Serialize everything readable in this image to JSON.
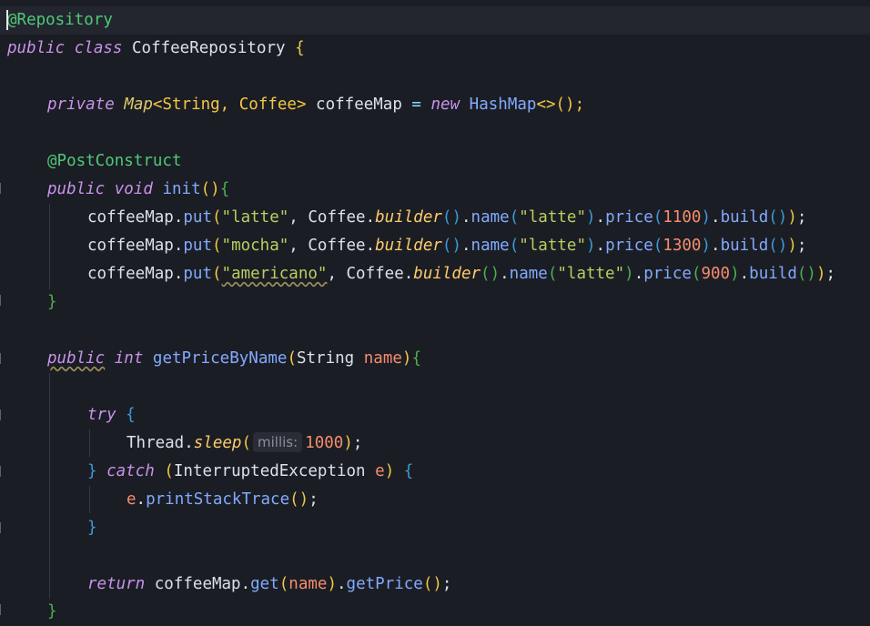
{
  "lines": {
    "l1_annotation": "@Repository",
    "l2_class_decl": {
      "public": "public",
      "class": "class",
      "name": "CoffeeRepository",
      "brace": "{"
    },
    "l4_field": {
      "private": "private",
      "type_map": "Map",
      "generics": "<String, Coffee>",
      "var": "coffeeMap",
      "eq": "=",
      "new": "new",
      "type_hash": "HashMap",
      "diamond": "<>",
      "end": "();"
    },
    "l6_annotation": "@PostConstruct",
    "l7_init": {
      "public": "public",
      "void": "void",
      "name": "init",
      "parens": "()",
      "brace": "{"
    },
    "put_lines": [
      {
        "key": "\"latte\"",
        "name_val": "\"latte\"",
        "price": "1100"
      },
      {
        "key": "\"mocha\"",
        "name_val": "\"latte\"",
        "price": "1300"
      },
      {
        "key": "\"americano\"",
        "name_val": "\"latte\"",
        "price": "900"
      }
    ],
    "put_tokens": {
      "map": "coffeeMap",
      "put": "put",
      "coffee": "Coffee",
      "builder": "builder",
      "name": "name",
      "price": "price",
      "build": "build"
    },
    "l11_close": "}",
    "l13_method": {
      "public": "public",
      "int": "int",
      "name": "getPriceByName",
      "ptype": "String",
      "pname": "name"
    },
    "try_kw": "try",
    "thread": "Thread",
    "sleep": "sleep",
    "hint_label": "millis:",
    "sleep_value": "1000",
    "catch_kw": "catch",
    "exception_type": "InterruptedException",
    "exception_var": "e",
    "print_call": "printStackTrace",
    "return_kw": "return",
    "return_map": "coffeeMap",
    "get": "get",
    "name_arg": "name",
    "get_price": "getPrice"
  }
}
